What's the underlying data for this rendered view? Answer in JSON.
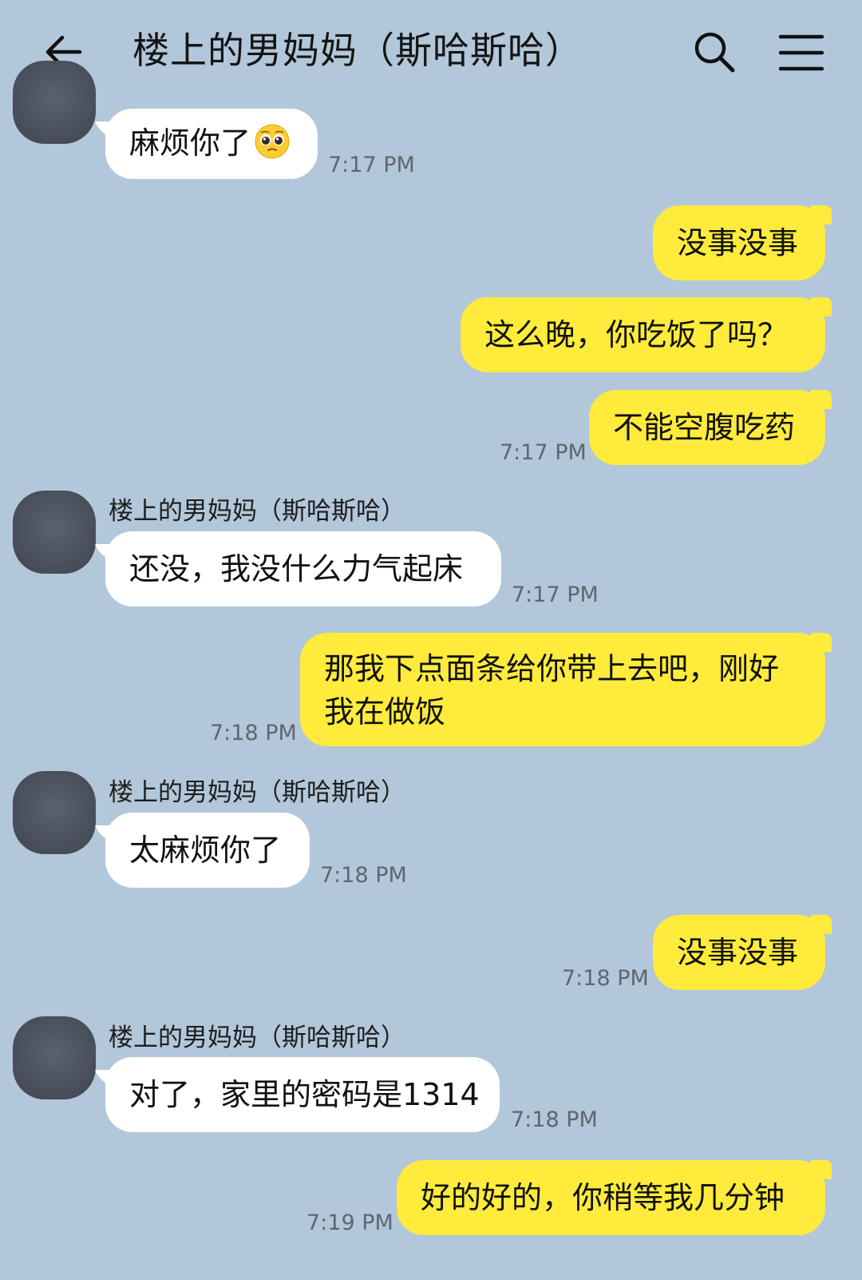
{
  "header": {
    "title": "楼上的男妈妈（斯哈斯哈）"
  },
  "contact_name": "楼上的男妈妈（斯哈斯哈）",
  "messages": [
    {
      "dir": "in",
      "text": "麻烦你了",
      "time": "7:17 PM",
      "emoji": "pleading-face-icon"
    },
    {
      "dir": "out",
      "text": "没事没事"
    },
    {
      "dir": "out",
      "text": "这么晚，你吃饭了吗？"
    },
    {
      "dir": "out",
      "text": "不能空腹吃药",
      "time": "7:17 PM"
    },
    {
      "dir": "in",
      "text": "还没，我没什么力气起床",
      "time": "7:17 PM"
    },
    {
      "dir": "out",
      "line1": "那我下点面条给你带上去吧，刚好",
      "line2": "我在做饭",
      "time": "7:18 PM"
    },
    {
      "dir": "in",
      "text": "太麻烦你了",
      "time": "7:18 PM"
    },
    {
      "dir": "out",
      "text": "没事没事",
      "time": "7:18 PM"
    },
    {
      "dir": "in",
      "text": "对了，家里的密码是1314",
      "time": "7:18 PM"
    },
    {
      "dir": "out",
      "text": "好的好的，你稍等我几分钟",
      "time": "7:19 PM"
    }
  ],
  "colors": {
    "background": "#b2c7da",
    "outgoing_bubble": "#ffeb3b",
    "incoming_bubble": "#ffffff",
    "avatar": "#4a505c",
    "timestamp": "#5e6670"
  }
}
